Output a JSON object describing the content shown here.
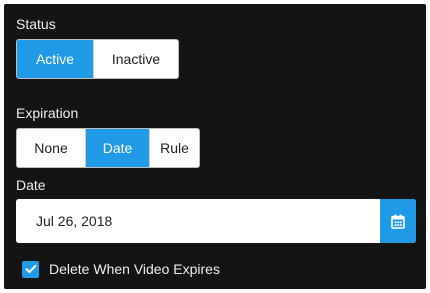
{
  "status": {
    "label": "Status",
    "options": [
      "Active",
      "Inactive"
    ],
    "selected": "Active"
  },
  "expiration": {
    "label": "Expiration",
    "options": [
      "None",
      "Date",
      "Rule"
    ],
    "selected": "Date"
  },
  "date": {
    "label": "Date",
    "value": "Jul 26, 2018",
    "calendar_icon": "calendar-icon"
  },
  "delete_when_expires": {
    "label": "Delete When Video Expires",
    "checked": true
  },
  "colors": {
    "accent": "#1f9ae6",
    "panel_background": "#141414",
    "button_background": "#ffffff",
    "label_text": "#eeeeee"
  }
}
